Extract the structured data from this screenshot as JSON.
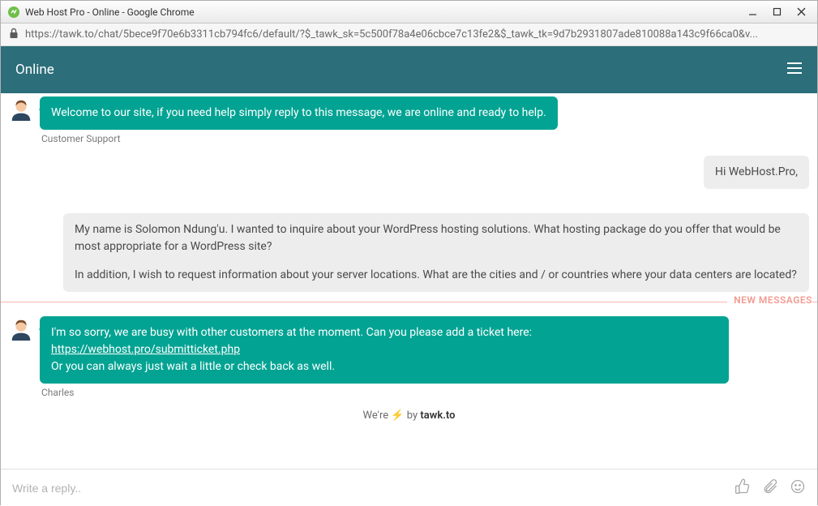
{
  "window": {
    "title": "Web Host Pro - Online - Google Chrome"
  },
  "addressbar": {
    "url": "https://tawk.to/chat/5bece9f70e6b3311cb794fc6/default/?$_tawk_sk=5c500f78a4e06cbce7c13fe2&$_tawk_tk=9d7b2931807ade810088a143c9f66ca0&v..."
  },
  "header": {
    "status": "Online"
  },
  "messages": {
    "agent1": {
      "text": "Welcome to our site, if you need help simply reply to this message, we are online and ready to help.",
      "sender": "Customer Support"
    },
    "user1": {
      "text": "Hi WebHost.Pro,"
    },
    "user2": {
      "p1": "My name is Solomon Ndung'u. I wanted to inquire about your WordPress hosting solutions. What hosting package do you offer that would be most appropriate for a WordPress site?",
      "p2": "In addition, I wish to request information about your server locations. What are the cities and / or countries where your data centers are located?"
    },
    "agent2": {
      "line1_pre": "I'm so sorry, we are busy with other customers at the moment. Can you please add a ticket here: ",
      "link": "https://webhost.pro/submitticket.php",
      "line2": "Or you can always just wait a little or check back as well.",
      "sender": "Charles"
    }
  },
  "divider": {
    "new_messages": "NEW MESSAGES"
  },
  "powered": {
    "prefix": "We're",
    "by": " by ",
    "brand": "tawk.to"
  },
  "reply": {
    "placeholder": "Write a reply.."
  },
  "icons": {
    "lock": "lock-icon",
    "hamburger": "hamburger-icon",
    "thumbs": "thumbs-up-icon",
    "attach": "paperclip-icon",
    "emoji": "smile-icon",
    "bolt": "bolt-icon",
    "minimize": "minimize-icon",
    "maximize": "maximize-icon",
    "close": "close-icon"
  }
}
